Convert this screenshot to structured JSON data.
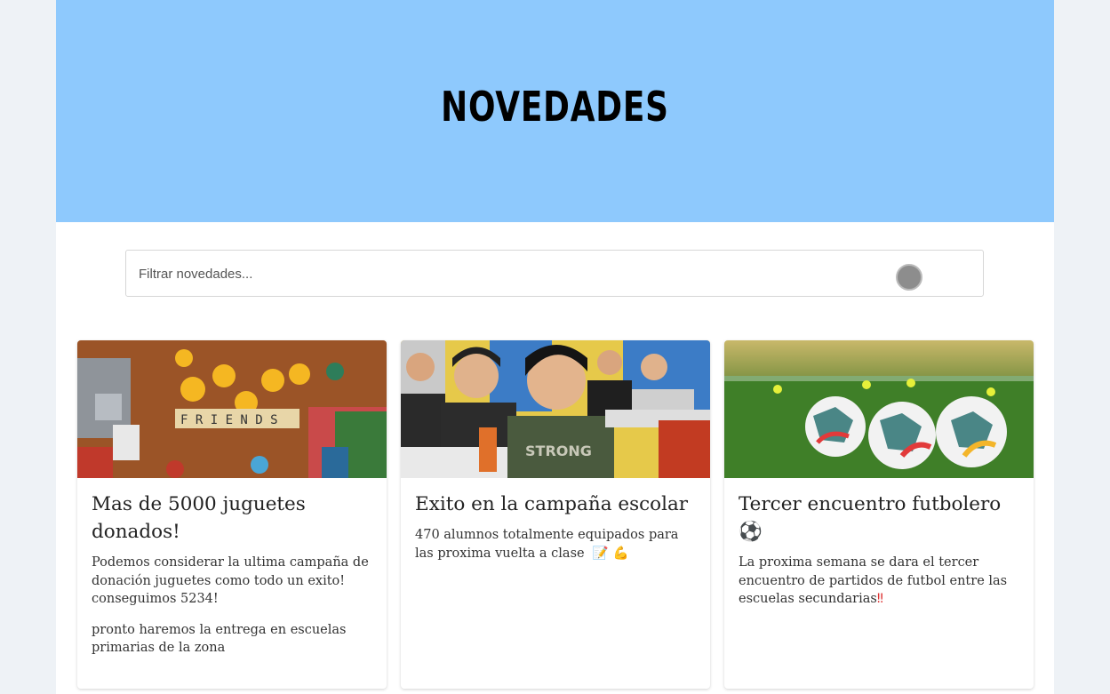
{
  "header": {
    "title": "NOVEDADES"
  },
  "search": {
    "placeholder": "Filtrar novedades..."
  },
  "cards": [
    {
      "image": "toys-photo",
      "title": "Mas de 5000 juguetes donados!",
      "paragraphs": [
        "Podemos considerar la ultima campaña de donación juguetes como todo un exito! conseguimos 5234!",
        "pronto haremos la entrega en escuelas primarias de la zona"
      ]
    },
    {
      "image": "classroom-photo",
      "title": "Exito en la campaña escolar",
      "paragraphs": [
        "470 alumnos totalmente equipados para las proxima vuelta a clase"
      ],
      "emojis": "📝 💪"
    },
    {
      "image": "soccer-balls-photo",
      "title": "Tercer encuentro futbolero",
      "title_emoji": "⚽",
      "paragraphs": [
        "La proxima semana se dara el tercer encuentro de partidos de futbol entre las escuelas secundarias"
      ],
      "emojis": "‼"
    }
  ]
}
